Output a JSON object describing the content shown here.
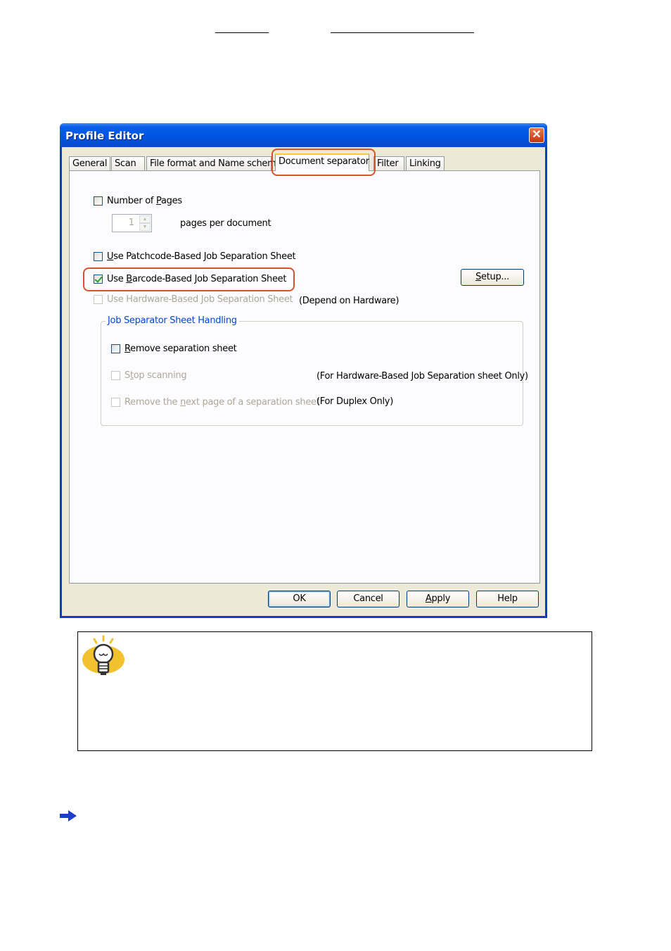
{
  "window": {
    "title": "Profile Editor",
    "close_glyph": "✕"
  },
  "tabs": [
    {
      "label": "General"
    },
    {
      "label": "Scan"
    },
    {
      "label": "File format and Name scheme"
    },
    {
      "label": "Document separator",
      "active": true
    },
    {
      "label": "Filter"
    },
    {
      "label": "Linking"
    }
  ],
  "separator": {
    "number_of_pages": {
      "label_pre": "Number of ",
      "label_u": "P",
      "label_post": "ages",
      "checked": false
    },
    "pages_value": "1",
    "pages_suffix": "pages per document",
    "patchcode": {
      "label_u": "U",
      "label_post": "se Patchcode-Based Job Separation Sheet",
      "checked": false
    },
    "barcode": {
      "label_pre": "Use ",
      "label_u": "B",
      "label_post": "arcode-Based Job Separation Sheet",
      "checked": true
    },
    "setup_button": {
      "label_u": "S",
      "label_post": "etup..."
    },
    "hardware": {
      "label_pre": "Use Hardware-Based ",
      "label_u": "J",
      "label_post": "ob Separation Sheet",
      "checked": false,
      "disabled": true
    },
    "hardware_note": "(Depend on Hardware)"
  },
  "group": {
    "title": "Job Separator Sheet Handling",
    "remove_sheet": {
      "label_u": "R",
      "label_post": "emove separation sheet",
      "checked": false
    },
    "stop_scanning": {
      "label_pre": "S",
      "label_u": "t",
      "label_post": "op scanning",
      "checked": false,
      "disabled": true
    },
    "stop_note": "(For Hardware-Based Job Separation sheet Only)",
    "remove_next": {
      "label_pre": "Remove the ",
      "label_u": "n",
      "label_post": "ext page of a separation sheet",
      "checked": false,
      "disabled": true
    },
    "remove_next_note": "(For Duplex Only)"
  },
  "buttons": {
    "ok": "OK",
    "cancel": "Cancel",
    "apply_u": "A",
    "apply_post": "pply",
    "help": "Help"
  },
  "colors": {
    "highlight": "#d9532a",
    "titlebar": "#0054e3",
    "group_title": "#0046d5"
  },
  "icons": {
    "hint": "lightbulb-icon",
    "arrow": "right-arrow-icon"
  }
}
